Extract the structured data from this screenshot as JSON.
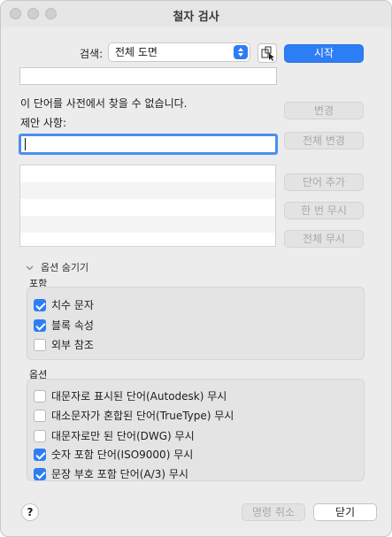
{
  "window": {
    "title": "철자 검사"
  },
  "search": {
    "label": "검색:",
    "selected": "전체 도면",
    "start_label": "시작"
  },
  "status": {
    "message": "이 단어를 사전에서 찾을 수 없습니다.",
    "suggestion_label": "제안 사항:"
  },
  "buttons": {
    "change": "변경",
    "change_all": "전체 변경",
    "add_word": "단어 추가",
    "ignore_once": "한 번 무시",
    "ignore_all": "전체 무시",
    "cancel_command": "명령 취소",
    "close": "닫기",
    "help": "?"
  },
  "options_toggle": "옵션 숨기기",
  "include": {
    "heading": "포함",
    "items": [
      {
        "label": "치수 문자",
        "checked": true
      },
      {
        "label": "블록 속성",
        "checked": true
      },
      {
        "label": "외부 참조",
        "checked": false
      }
    ]
  },
  "options": {
    "heading": "옵션",
    "items": [
      {
        "label": "대문자로 표시된 단어(Autodesk) 무시",
        "checked": false
      },
      {
        "label": "대소문자가 혼합된 단어(TrueType) 무시",
        "checked": false
      },
      {
        "label": "대문자로만 된 단어(DWG) 무시",
        "checked": false
      },
      {
        "label": "숫자 포함 단어(ISO9000) 무시",
        "checked": true
      },
      {
        "label": "문장 부호 포함 단어(A/3) 무시",
        "checked": true
      }
    ]
  }
}
